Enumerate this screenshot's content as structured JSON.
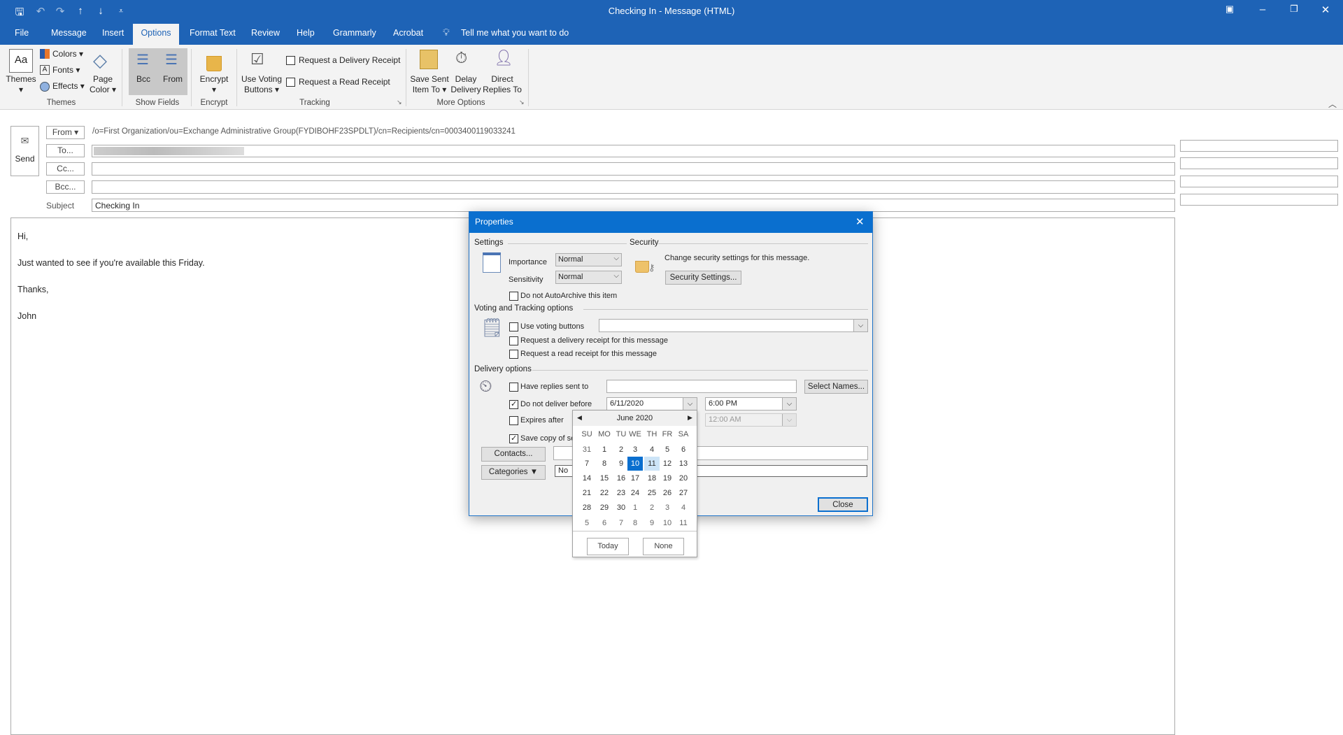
{
  "window": {
    "title": "Checking In  -  Message (HTML)",
    "qat": [
      "save-icon",
      "undo-icon",
      "redo-icon",
      "up-arrow-icon",
      "down-arrow-icon",
      "customize-icon"
    ],
    "controls": [
      "ribbon-display-icon",
      "minimize-icon",
      "restore-icon",
      "close-icon"
    ]
  },
  "tabs": [
    {
      "label": "File"
    },
    {
      "label": "Message"
    },
    {
      "label": "Insert"
    },
    {
      "label": "Options",
      "active": true
    },
    {
      "label": "Format Text"
    },
    {
      "label": "Review"
    },
    {
      "label": "Help"
    },
    {
      "label": "Grammarly"
    },
    {
      "label": "Acrobat"
    }
  ],
  "tell_me": "Tell me what you want to do",
  "ribbon": {
    "themes": {
      "themes": "Themes",
      "colors": "Colors",
      "fonts": "Fonts",
      "effects": "Effects",
      "page_color_1": "Page",
      "page_color_2": "Color",
      "group": "Themes"
    },
    "show_fields": {
      "bcc": "Bcc",
      "from": "From",
      "group": "Show Fields"
    },
    "encrypt": {
      "encrypt": "Encrypt",
      "group": "Encrypt"
    },
    "tracking": {
      "voting_1": "Use Voting",
      "voting_2": "Buttons",
      "delivery_receipt": "Request a Delivery Receipt",
      "read_receipt": "Request a Read Receipt",
      "group": "Tracking"
    },
    "more": {
      "save_1": "Save Sent",
      "save_2": "Item To",
      "delay_1": "Delay",
      "delay_2": "Delivery",
      "direct_1": "Direct",
      "direct_2": "Replies To",
      "group": "More Options"
    }
  },
  "compose": {
    "send": "Send",
    "from_btn": "From",
    "from_value": "/o=First Organization/ou=Exchange Administrative Group(FYDIBOHF23SPDLT)/cn=Recipients/cn=0003400119033241",
    "to_btn": "To...",
    "cc_btn": "Cc...",
    "bcc_btn": "Bcc...",
    "subject_label": "Subject",
    "subject": "Checking In",
    "body": [
      "Hi,",
      "Just wanted to see if you're available this Friday.",
      "Thanks,",
      "John"
    ]
  },
  "dialog": {
    "title": "Properties",
    "settings": "Settings",
    "importance_label": "Importance",
    "importance": "Normal",
    "sensitivity_label": "Sensitivity",
    "sensitivity": "Normal",
    "security": "Security",
    "security_text": "Change security settings for this message.",
    "security_btn": "Security Settings...",
    "autoarchive": "Do not AutoArchive this item",
    "voting_section": "Voting and Tracking options",
    "use_voting": "Use voting buttons",
    "delivery_receipt": "Request a delivery receipt for this message",
    "read_receipt": "Request a read receipt for this message",
    "delivery_section": "Delivery options",
    "have_replies": "Have replies sent to",
    "select_names": "Select Names...",
    "do_not_deliver": "Do not deliver before",
    "deliver_date": "6/11/2020",
    "deliver_time": "6:00 PM",
    "expires": "Expires after",
    "expires_time": "12:00 AM",
    "save_copy": "Save copy of se",
    "contacts": "Contacts...",
    "categories": "Categories",
    "categories_value": "No",
    "close": "Close"
  },
  "calendar": {
    "month": "June 2020",
    "days": [
      "SU",
      "MO",
      "TU",
      "WE",
      "TH",
      "FR",
      "SA"
    ],
    "weeks": [
      [
        "31",
        "1",
        "2",
        "3",
        "4",
        "5",
        "6"
      ],
      [
        "7",
        "8",
        "9",
        "10",
        "11",
        "12",
        "13"
      ],
      [
        "14",
        "15",
        "16",
        "17",
        "18",
        "19",
        "20"
      ],
      [
        "21",
        "22",
        "23",
        "24",
        "25",
        "26",
        "27"
      ],
      [
        "28",
        "29",
        "30",
        "1",
        "2",
        "3",
        "4"
      ],
      [
        "5",
        "6",
        "7",
        "8",
        "9",
        "10",
        "11"
      ]
    ],
    "selected": "10",
    "hover": "11",
    "today": "Today",
    "none": "None",
    "accent": "#0a6fcf"
  }
}
